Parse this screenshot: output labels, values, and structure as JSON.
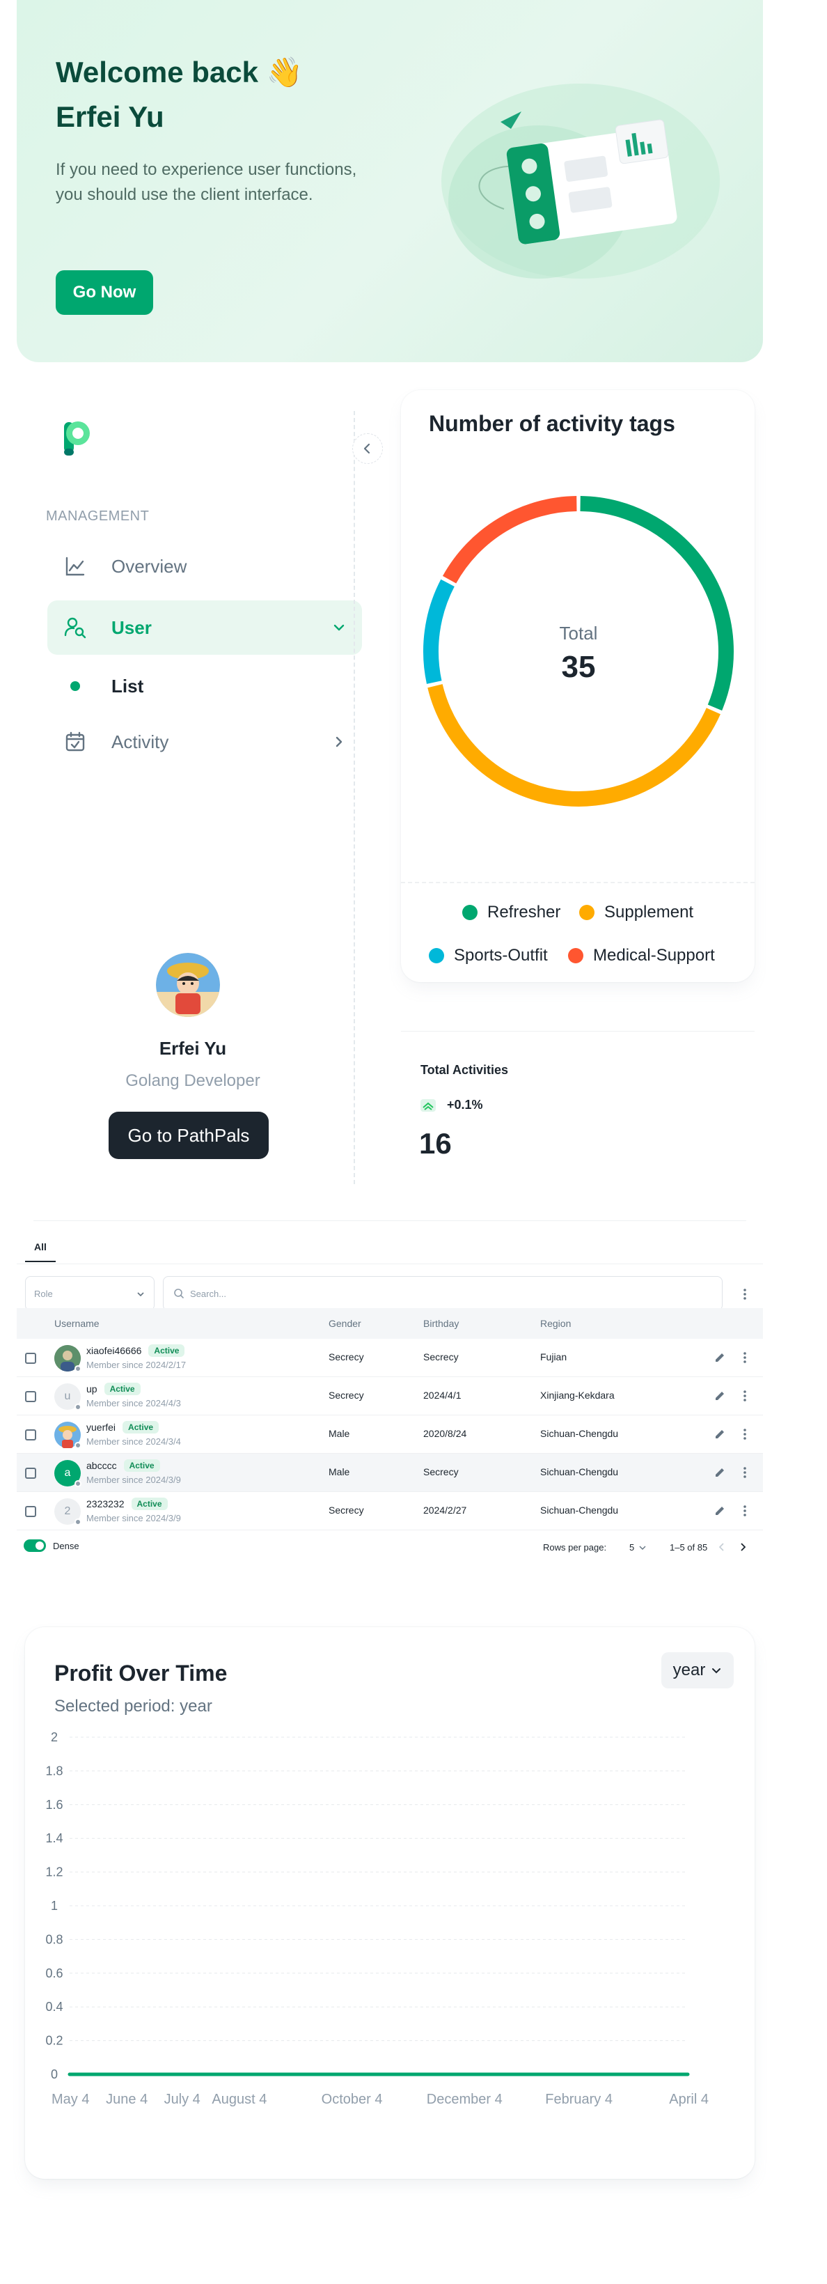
{
  "welcome": {
    "title_line1": "Welcome back 👋",
    "title_line2": "Erfei Yu",
    "description": "If you need to experience user functions, you should use the client interface.",
    "button": "Go Now"
  },
  "sidebar": {
    "section_label": "MANAGEMENT",
    "items": [
      {
        "label": "Overview",
        "icon": "chart-line-icon"
      },
      {
        "label": "User",
        "icon": "user-search-icon"
      },
      {
        "label": "List",
        "icon": "dot-icon"
      },
      {
        "label": "Activity",
        "icon": "calendar-check-icon"
      }
    ],
    "profile": {
      "name": "Erfei Yu",
      "role": "Golang Developer",
      "button": "Go to PathPals"
    }
  },
  "donut": {
    "title": "Number of activity tags",
    "center_label": "Total",
    "center_value": "35",
    "legend": [
      "Refresher",
      "Supplement",
      "Sports-Outfit",
      "Medical-Support"
    ],
    "colors": [
      "#00A76F",
      "#FFAB00",
      "#00B8D9",
      "#FF5630"
    ]
  },
  "chart_data": [
    {
      "type": "pie",
      "title": "Number of activity tags",
      "categories": [
        "Refresher",
        "Supplement",
        "Sports-Outfit",
        "Medical-Support"
      ],
      "values": [
        11,
        14,
        4,
        6
      ],
      "total": 35
    },
    {
      "type": "line",
      "title": "Profit Over Time",
      "x": [
        "May 4",
        "June 4",
        "July 4",
        "August 4",
        "October 4",
        "December 4",
        "February 4",
        "April 4"
      ],
      "x_days": [
        0,
        31,
        61,
        92,
        153,
        214,
        276,
        335
      ],
      "series": [
        {
          "values": [
            0,
            0,
            0,
            0,
            0,
            0,
            0,
            0
          ]
        }
      ],
      "ylim": [
        0,
        2
      ],
      "yticks": [
        "0",
        "0.2",
        "0.4",
        "0.6",
        "0.8",
        "1",
        "1.2",
        "1.4",
        "1.6",
        "1.8",
        "2"
      ],
      "grid": true
    }
  ],
  "total_activities": {
    "label": "Total Activities",
    "change": "+0.1%",
    "value": "16"
  },
  "table": {
    "tab": "All",
    "role_placeholder": "Role",
    "search_placeholder": "Search...",
    "headers": [
      "Username",
      "Gender",
      "Birthday",
      "Region"
    ],
    "rows": [
      {
        "avatar": "",
        "name": "xiaofei46666",
        "status": "Active",
        "since": "Member since 2024/2/17",
        "gender": "Secrecy",
        "birthday": "Secrecy",
        "region": "Fujian"
      },
      {
        "avatar": "u",
        "name": "up",
        "status": "Active",
        "since": "Member since 2024/4/3",
        "gender": "Secrecy",
        "birthday": "2024/4/1",
        "region": "Xinjiang-Kekdara"
      },
      {
        "avatar": "",
        "name": "yuerfei",
        "status": "Active",
        "since": "Member since 2024/3/4",
        "gender": "Male",
        "birthday": "2020/8/24",
        "region": "Sichuan-Chengdu"
      },
      {
        "avatar": "a",
        "name": "abcccc",
        "status": "Active",
        "since": "Member since 2024/3/9",
        "gender": "Male",
        "birthday": "Secrecy",
        "region": "Sichuan-Chengdu"
      },
      {
        "avatar": "2",
        "name": "2323232",
        "status": "Active",
        "since": "Member since 2024/3/9",
        "gender": "Secrecy",
        "birthday": "2024/2/27",
        "region": "Sichuan-Chengdu"
      }
    ],
    "dense_label": "Dense",
    "rows_per_page_label": "Rows per page:",
    "rows_per_page": "5",
    "pagination": "1–5 of 85"
  },
  "profit": {
    "title": "Profit Over Time",
    "subtitle": "Selected period: year",
    "period": "year"
  },
  "colors": {
    "primary": "#00A76F",
    "text": "#1C252E",
    "secondary_text": "#637381",
    "dark_button": "#1C252E"
  }
}
